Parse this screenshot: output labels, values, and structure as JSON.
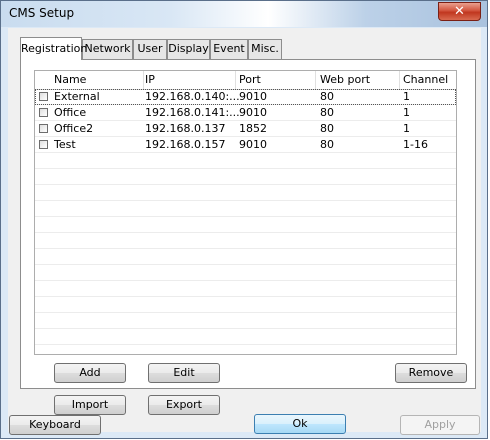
{
  "window": {
    "title": "CMS Setup"
  },
  "tabs": [
    {
      "label": "Registration",
      "active": true
    },
    {
      "label": "Network",
      "active": false
    },
    {
      "label": "User",
      "active": false
    },
    {
      "label": "Display",
      "active": false
    },
    {
      "label": "Event",
      "active": false
    },
    {
      "label": "Misc.",
      "active": false
    }
  ],
  "table": {
    "columns": [
      "Name",
      "IP",
      "Port",
      "Web port",
      "Channel"
    ],
    "rows": [
      {
        "checked": false,
        "name": "External",
        "ip": "192.168.0.140:...",
        "port": "9010",
        "web_port": "80",
        "channel": "1"
      },
      {
        "checked": false,
        "name": "Office",
        "ip": "192.168.0.141:...",
        "port": "9010",
        "web_port": "80",
        "channel": "1"
      },
      {
        "checked": false,
        "name": "Office2",
        "ip": "192.168.0.137",
        "port": "1852",
        "web_port": "80",
        "channel": "1"
      },
      {
        "checked": false,
        "name": "Test",
        "ip": "192.168.0.157",
        "port": "9010",
        "web_port": "80",
        "channel": "1-16"
      }
    ]
  },
  "buttons": {
    "add": "Add",
    "edit": "Edit",
    "remove": "Remove",
    "import": "Import",
    "export": "Export",
    "keyboard": "Keyboard",
    "ok": "Ok",
    "apply": "Apply"
  }
}
